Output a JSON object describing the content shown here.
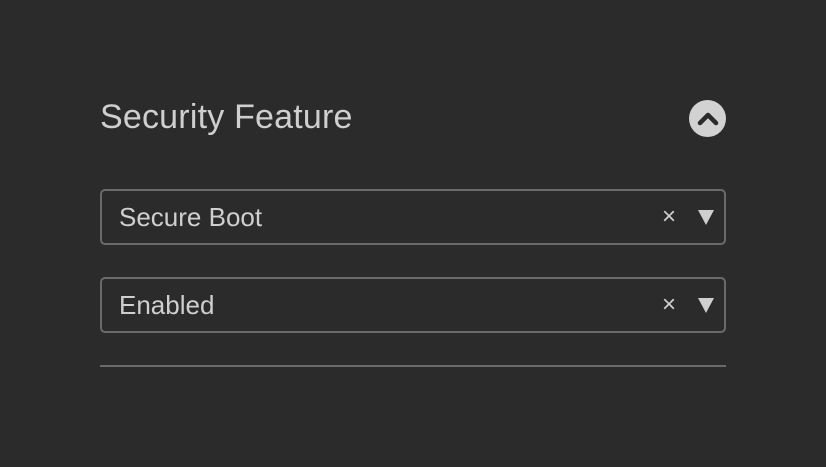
{
  "section": {
    "title": "Security Feature",
    "collapse_icon": "chevron-up-icon"
  },
  "feature_select": {
    "value": "Secure Boot",
    "clear_label": "×"
  },
  "state_select": {
    "value": "Enabled",
    "clear_label": "×"
  },
  "colors": {
    "background": "#2b2b2b",
    "text": "#cfcfcf",
    "border": "#6a6a6a"
  }
}
